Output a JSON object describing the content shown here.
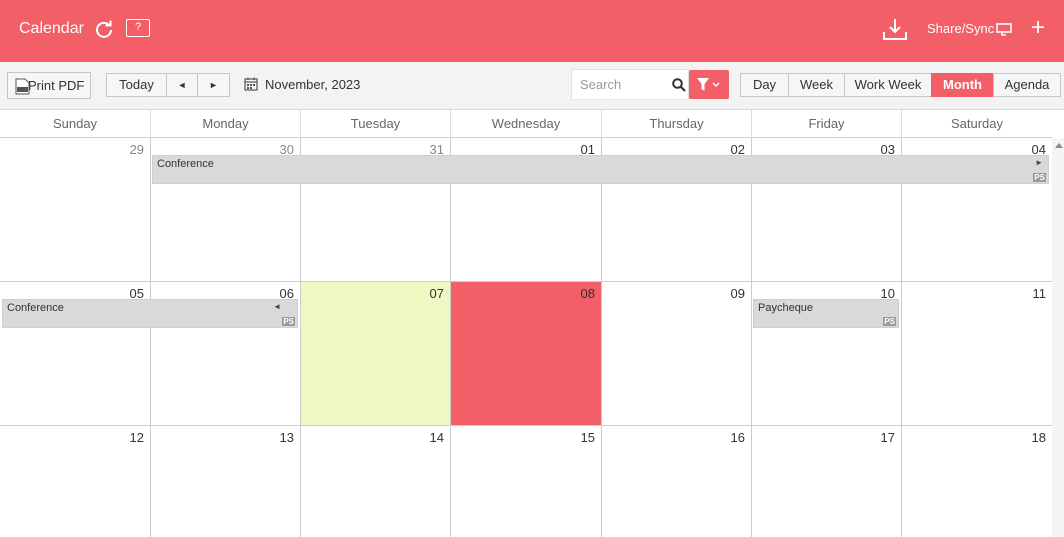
{
  "header": {
    "title": "Calendar",
    "help_label": "?",
    "share_label": "Share/Sync",
    "add_label": "+",
    "bg_color": "#f25f67"
  },
  "toolbar": {
    "print_label": "Print PDF",
    "today_label": "Today",
    "prev_label": "◄",
    "next_label": "►",
    "month_label": "November, 2023",
    "search_placeholder": "Search",
    "views": [
      {
        "label": "Day",
        "active": false
      },
      {
        "label": "Week",
        "active": false
      },
      {
        "label": "Work Week",
        "active": false
      },
      {
        "label": "Month",
        "active": true
      },
      {
        "label": "Agenda",
        "active": false
      }
    ]
  },
  "calendar": {
    "day_names": [
      "Sunday",
      "Monday",
      "Tuesday",
      "Wednesday",
      "Thursday",
      "Friday",
      "Saturday"
    ],
    "weeks": [
      [
        "29",
        "30",
        "31",
        "01",
        "02",
        "03",
        "04"
      ],
      [
        "05",
        "06",
        "07",
        "08",
        "09",
        "10",
        "11"
      ],
      [
        "12",
        "13",
        "14",
        "15",
        "16",
        "17",
        "18"
      ]
    ],
    "events": [
      {
        "title": "Conference",
        "badge": "PS",
        "continues": "►"
      },
      {
        "title": "Conference",
        "badge": "PS",
        "continues": "◄"
      },
      {
        "title": "Paycheque",
        "badge": "PS"
      }
    ],
    "today_color": "#f25f67",
    "selected_color": "#eff7c2"
  }
}
